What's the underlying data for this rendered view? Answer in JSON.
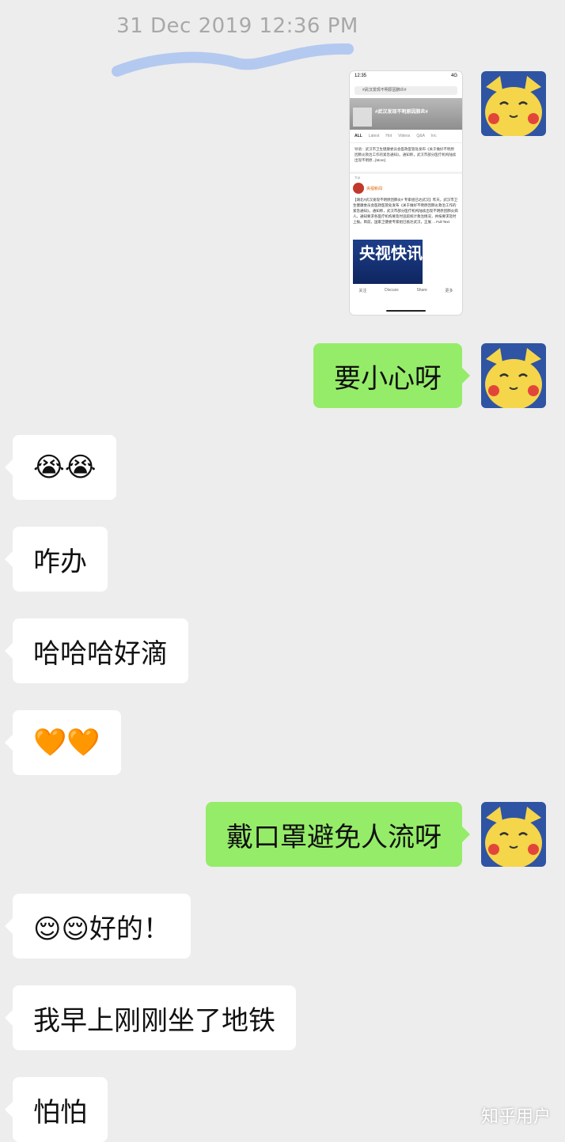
{
  "chat": {
    "timestamp": "31 Dec 2019 12:36 PM",
    "watermark": "知乎用户",
    "shared_screenshot": {
      "time": "12:35",
      "signal": "4G",
      "search": "#武汉发现不明原因肺炎#",
      "banner_title": "#武汉发现不明原因肺炎#",
      "tabs": [
        "ALL",
        "Latest",
        "Hot",
        "Videos",
        "Q&A",
        "Inc"
      ],
      "lead_text": "导语：武汉市卫生健康委员会医政医管处发布《关于做好不明原因肺炎救治工作的紧急通知》。通知称，武汉市部分医疗机构陆续出现不明原...[More]",
      "top_label": "Top",
      "post_author": "央视新闻",
      "post_text": "【湖北#武汉发现不明原因肺炎# 专家组已达武汉】昨天，武汉市卫生健康委员会医政医管处发布《关于做好不明原因肺炎救治工作的紧急通知》。通知称，武汉市部分医疗机构陆续出现不明原因肺炎病人。通知要求各医疗机构要及时追踪统计救治情况，并按要求及时上报。目前，国家卫健委专家组已抵达武汉，正展 ... Full Text",
      "video_text": "央视快讯",
      "actions": [
        "关注",
        "Discuss",
        "Share",
        "更多"
      ]
    },
    "messages": [
      {
        "side": "right",
        "text": "要小心呀"
      },
      {
        "side": "left",
        "text": "😭😭"
      },
      {
        "side": "left",
        "text": "咋办"
      },
      {
        "side": "left",
        "text": "哈哈哈好滴"
      },
      {
        "side": "left",
        "text": "🧡🧡"
      },
      {
        "side": "right",
        "text": "戴口罩避免人流呀"
      },
      {
        "side": "left",
        "text": "😌😌好的！"
      },
      {
        "side": "left",
        "text": "我早上刚刚坐了地铁"
      },
      {
        "side": "left",
        "text": "怕怕"
      }
    ]
  },
  "colors": {
    "background": "#ededed",
    "bubble_right": "#95ec69",
    "bubble_left": "#ffffff",
    "avatar_bg": "#2f54a3",
    "avatar_face": "#f5d54a"
  },
  "icons": {
    "avatar": "pikachu-avatar-icon"
  }
}
